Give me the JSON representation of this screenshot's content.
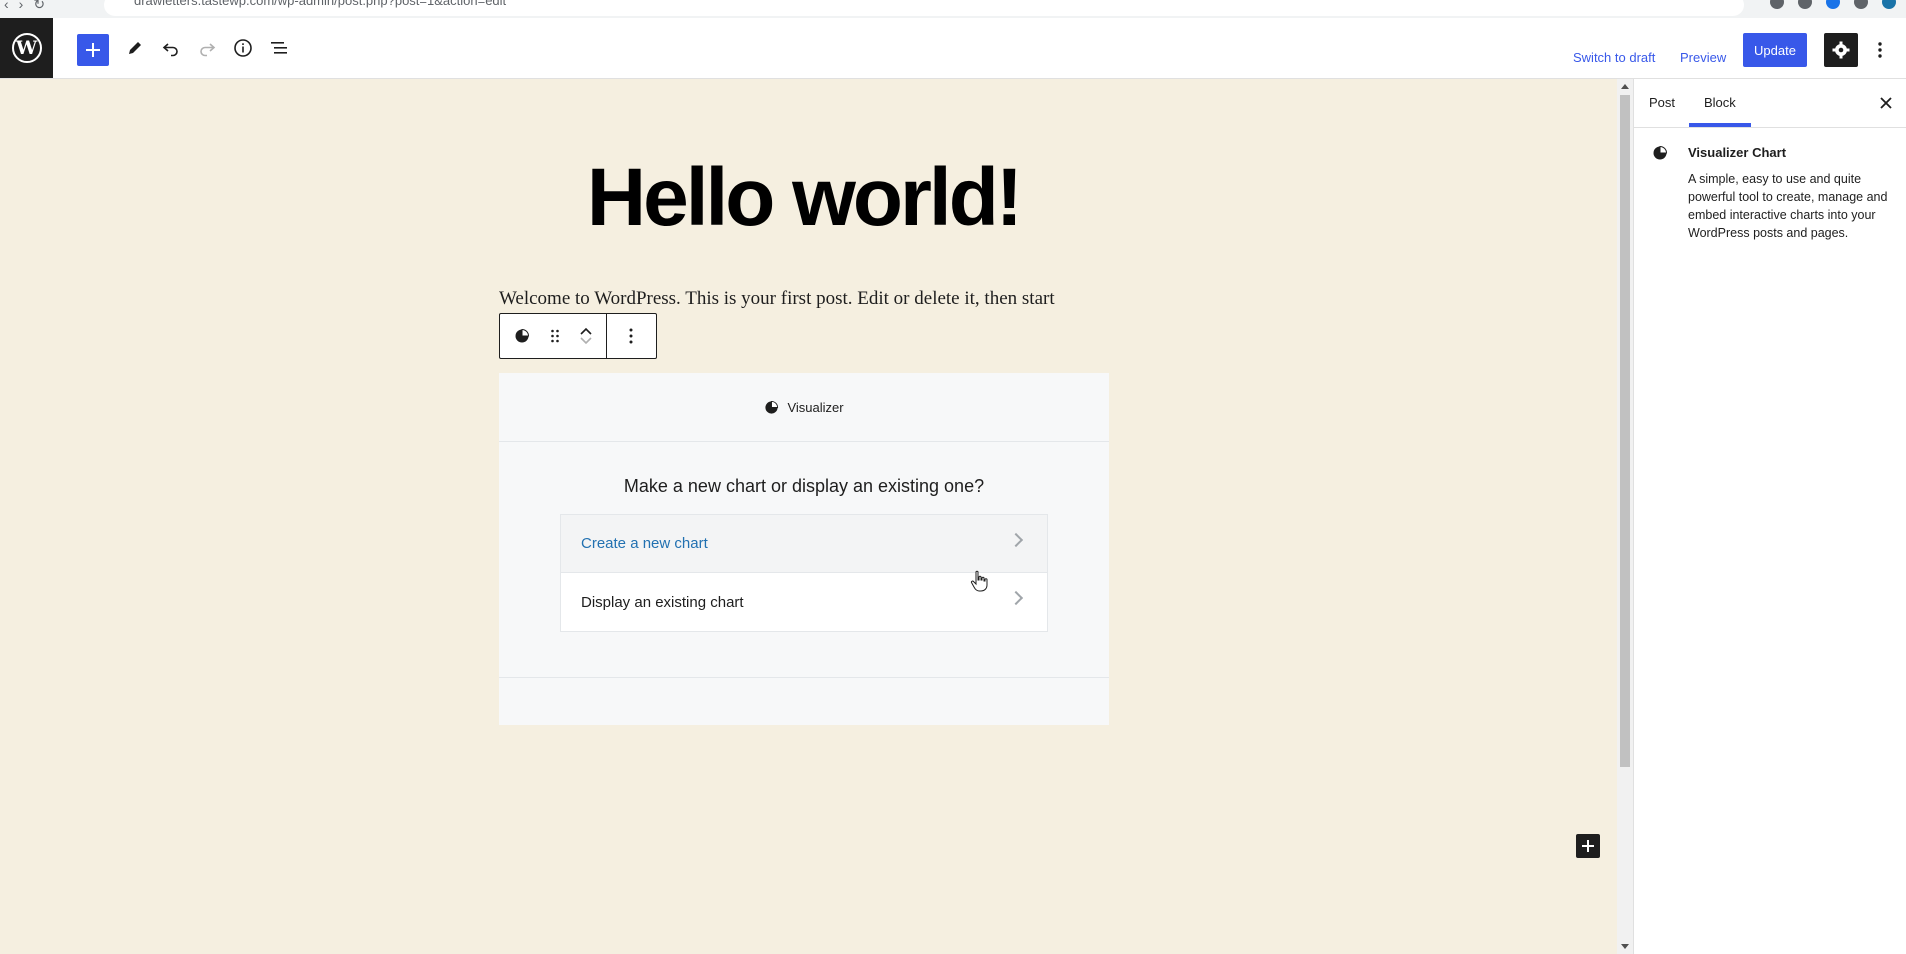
{
  "browser": {
    "url": "drawletters.tastewp.com/wp-admin/post.php?post=1&action=edit"
  },
  "header": {
    "switch_to_draft_label": "Switch to draft",
    "preview_label": "Preview",
    "update_label": "Update",
    "add_icon": "plus-icon",
    "tools_icon": "pencil-icon",
    "undo_icon": "undo-icon",
    "redo_icon": "redo-icon",
    "details_icon": "info-icon",
    "list_view_icon": "list-view-icon",
    "settings_icon": "gear-icon",
    "options_icon": "vertical-ellipsis-icon",
    "accent_color": "#3858e9"
  },
  "post": {
    "title": "Hello world!",
    "paragraph": "Welcome to WordPress. This is your first post. Edit or delete it, then start"
  },
  "visualizer_block": {
    "label": "Visualizer",
    "question": "Make a new chart or display an existing one?",
    "options": [
      {
        "label": "Create a new chart"
      },
      {
        "label": "Display an existing chart"
      }
    ]
  },
  "sidebar": {
    "tabs": [
      {
        "label": "Post",
        "active": false
      },
      {
        "label": "Block",
        "active": true
      }
    ],
    "block_card": {
      "title": "Visualizer Chart",
      "description": "A simple, easy to use and quite powerful tool to create, manage and embed interactive charts into your WordPress posts and pages."
    }
  },
  "colors": {
    "canvas_background": "#f5efe0",
    "link": "#2271b1"
  }
}
